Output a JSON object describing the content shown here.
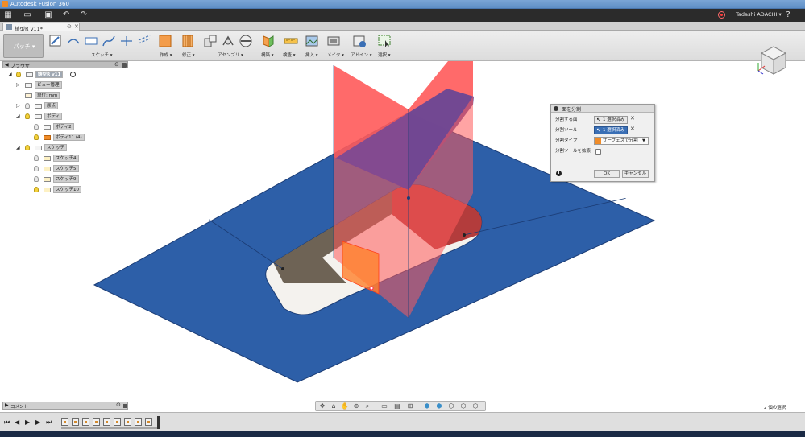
{
  "window": {
    "title": "Autodesk Fusion 360"
  },
  "appbar": {
    "user_name": "Tadashi ADACHI ▾",
    "help": "?"
  },
  "tab": {
    "name": "鋳型R v11*"
  },
  "toolbar": {
    "workspace": "パッチ ▾",
    "groups": [
      {
        "label": "スケッチ ▾"
      },
      {
        "label": "作成 ▾"
      },
      {
        "label": "修正 ▾"
      },
      {
        "label": "アセンブリ ▾"
      },
      {
        "label": "構築 ▾"
      },
      {
        "label": "検査 ▾"
      },
      {
        "label": "挿入 ▾"
      },
      {
        "label": "メイク ▾"
      },
      {
        "label": "アドイン ▾"
      },
      {
        "label": "選択 ▾"
      }
    ]
  },
  "browser": {
    "title": "ブラウザ",
    "root": "鋳型R v11",
    "items": [
      {
        "label": "ビュー管理"
      },
      {
        "label": "単位: mm"
      },
      {
        "label": "原点"
      },
      {
        "label": "ボディ"
      },
      {
        "label": "ボディ2"
      },
      {
        "label": "ボディ11 (4)"
      },
      {
        "label": "スケッチ"
      },
      {
        "label": "スケッチ4"
      },
      {
        "label": "スケッチ5"
      },
      {
        "label": "スケッチ9"
      },
      {
        "label": "スケッチ10"
      }
    ]
  },
  "dialog": {
    "title": "面を分割",
    "face_label": "分割する面",
    "face_value": "1 選択済み",
    "tool_label": "分割ツール",
    "tool_value": "1 選択済み",
    "type_label": "分割タイプ",
    "type_value": "サーフェスで分割",
    "extend_label": "分割ツールを拡張",
    "extend_checked": false,
    "ok": "OK",
    "cancel": "キャンセル"
  },
  "comment": {
    "title": "コメント"
  },
  "status": {
    "selection": "2 個の選択"
  },
  "colors": {
    "surface_blue": "#2d5fa8",
    "red_plane": "#ff5a5a",
    "orange_face": "#ff7f2a",
    "accent": "#3a6fb5"
  }
}
